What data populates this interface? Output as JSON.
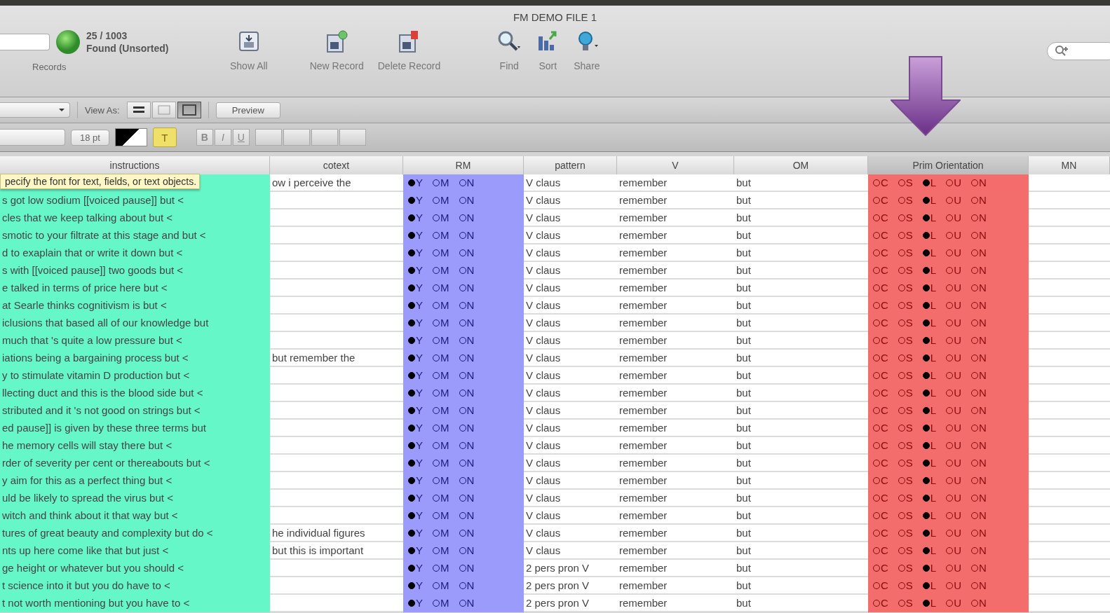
{
  "window": {
    "title": "FM DEMO FILE 1"
  },
  "toolbar": {
    "record_count": "25 / 1003",
    "found_status": "Found (Unsorted)",
    "records_label": "Records",
    "buttons": [
      {
        "label": "Show All",
        "kind": "show-all"
      },
      {
        "label": "New Record",
        "kind": "new"
      },
      {
        "label": "Delete Record",
        "kind": "delete"
      },
      {
        "label": "Find",
        "kind": "find"
      },
      {
        "label": "Sort",
        "kind": "sort"
      },
      {
        "label": "Share",
        "kind": "share"
      }
    ]
  },
  "layout_bar": {
    "view_as_label": "View As:",
    "views": [
      {
        "kind": "form",
        "selected": false
      },
      {
        "kind": "list",
        "selected": false
      },
      {
        "kind": "table",
        "selected": true
      }
    ],
    "preview_button": "Preview"
  },
  "format_bar": {
    "font_size": "18 pt",
    "text_button": {
      "label": "T",
      "selected": true
    },
    "styles": [
      "B",
      "I",
      "U"
    ]
  },
  "tooltip": "pecify the font for text, fields, or text objects.",
  "table": {
    "columns": [
      {
        "label": "instructions",
        "color": "#66f7c9",
        "selected": false
      },
      {
        "label": "cotext",
        "selected": false
      },
      {
        "label": "RM",
        "color": "#9b9bfb",
        "selected": false
      },
      {
        "label": "pattern",
        "selected": false
      },
      {
        "label": "V",
        "selected": false
      },
      {
        "label": "OM",
        "selected": false
      },
      {
        "label": "Prim Orientation",
        "color": "#f26d6b",
        "selected": true
      },
      {
        "label": "MN",
        "selected": false
      }
    ],
    "rows": [
      {
        "context": "ow i perceive the",
        "rm": [
          {
            "label": "Y",
            "selected": true
          },
          {
            "label": "M",
            "selected": false
          },
          {
            "label": "N",
            "selected": false
          }
        ],
        "pattern": "V claus",
        "v": "remember",
        "om": "but",
        "prim_orientation": [
          {
            "label": "C",
            "selected": false
          },
          {
            "label": "S",
            "selected": false
          },
          {
            "label": "L",
            "selected": true
          },
          {
            "label": "U",
            "selected": false
          },
          {
            "label": "N",
            "selected": false
          }
        ]
      },
      {
        "instructions": "s got low sodium [[voiced pause]] but <",
        "rm": [
          {
            "label": "Y",
            "selected": true
          },
          {
            "label": "M",
            "selected": false
          },
          {
            "label": "N",
            "selected": false
          }
        ],
        "pattern": "V claus",
        "v": "remember",
        "om": "but",
        "prim_orientation": [
          {
            "label": "C",
            "selected": false
          },
          {
            "label": "S",
            "selected": false
          },
          {
            "label": "L",
            "selected": true
          },
          {
            "label": "U",
            "selected": false
          },
          {
            "label": "N",
            "selected": false
          }
        ]
      },
      {
        "instructions": "cles that we keep talking about but <",
        "rm": [
          {
            "label": "Y",
            "selected": true
          },
          {
            "label": "M",
            "selected": false
          },
          {
            "label": "N",
            "selected": false
          }
        ],
        "pattern": "V claus",
        "v": "remember",
        "om": "but",
        "prim_orientation": [
          {
            "label": "C",
            "selected": false
          },
          {
            "label": "S",
            "selected": false
          },
          {
            "label": "L",
            "selected": true
          },
          {
            "label": "U",
            "selected": false
          },
          {
            "label": "N",
            "selected": false
          }
        ]
      },
      {
        "instructions": "smotic to your filtrate at this stage and but <",
        "rm": [
          {
            "label": "Y",
            "selected": true
          },
          {
            "label": "M",
            "selected": false
          },
          {
            "label": "N",
            "selected": false
          }
        ],
        "pattern": "V claus",
        "v": "remember",
        "om": "but",
        "prim_orientation": [
          {
            "label": "C",
            "selected": false
          },
          {
            "label": "S",
            "selected": false
          },
          {
            "label": "L",
            "selected": true
          },
          {
            "label": "U",
            "selected": false
          },
          {
            "label": "N",
            "selected": false
          }
        ]
      },
      {
        "instructions": "d to exaplain that or write it down but <",
        "rm": [
          {
            "label": "Y",
            "selected": true
          },
          {
            "label": "M",
            "selected": false
          },
          {
            "label": "N",
            "selected": false
          }
        ],
        "pattern": "V claus",
        "v": "remember",
        "om": "but",
        "prim_orientation": [
          {
            "label": "C",
            "selected": false
          },
          {
            "label": "S",
            "selected": false
          },
          {
            "label": "L",
            "selected": true
          },
          {
            "label": "U",
            "selected": false
          },
          {
            "label": "N",
            "selected": false
          }
        ]
      },
      {
        "instructions": "s with [[voiced pause]] two goods but <",
        "rm": [
          {
            "label": "Y",
            "selected": true
          },
          {
            "label": "M",
            "selected": false
          },
          {
            "label": "N",
            "selected": false
          }
        ],
        "pattern": "V claus",
        "v": "remember",
        "om": "but",
        "prim_orientation": [
          {
            "label": "C",
            "selected": false
          },
          {
            "label": "S",
            "selected": false
          },
          {
            "label": "L",
            "selected": true
          },
          {
            "label": "U",
            "selected": false
          },
          {
            "label": "N",
            "selected": false
          }
        ]
      },
      {
        "instructions": "e talked in terms of price here but <",
        "rm": [
          {
            "label": "Y",
            "selected": true
          },
          {
            "label": "M",
            "selected": false
          },
          {
            "label": "N",
            "selected": false
          }
        ],
        "pattern": "V claus",
        "v": "remember",
        "om": "but",
        "prim_orientation": [
          {
            "label": "C",
            "selected": false
          },
          {
            "label": "S",
            "selected": false
          },
          {
            "label": "L",
            "selected": true
          },
          {
            "label": "U",
            "selected": false
          },
          {
            "label": "N",
            "selected": false
          }
        ]
      },
      {
        "instructions": "at Searle thinks cognitivism is but <",
        "rm": [
          {
            "label": "Y",
            "selected": true
          },
          {
            "label": "M",
            "selected": false
          },
          {
            "label": "N",
            "selected": false
          }
        ],
        "pattern": "V claus",
        "v": "remember",
        "om": "but",
        "prim_orientation": [
          {
            "label": "C",
            "selected": false
          },
          {
            "label": "S",
            "selected": false
          },
          {
            "label": "L",
            "selected": true
          },
          {
            "label": "U",
            "selected": false
          },
          {
            "label": "N",
            "selected": false
          }
        ]
      },
      {
        "instructions": "iclusions that based all of our knowledge but",
        "rm": [
          {
            "label": "Y",
            "selected": true
          },
          {
            "label": "M",
            "selected": false
          },
          {
            "label": "N",
            "selected": false
          }
        ],
        "pattern": "V claus",
        "v": "remember",
        "om": "but",
        "prim_orientation": [
          {
            "label": "C",
            "selected": false
          },
          {
            "label": "S",
            "selected": false
          },
          {
            "label": "L",
            "selected": true
          },
          {
            "label": "U",
            "selected": false
          },
          {
            "label": "N",
            "selected": false
          }
        ]
      },
      {
        "instructions": "much that 's quite a low pressure but <",
        "rm": [
          {
            "label": "Y",
            "selected": true
          },
          {
            "label": "M",
            "selected": false
          },
          {
            "label": "N",
            "selected": false
          }
        ],
        "pattern": "V claus",
        "v": "remember",
        "om": "but",
        "prim_orientation": [
          {
            "label": "C",
            "selected": false
          },
          {
            "label": "S",
            "selected": false
          },
          {
            "label": "L",
            "selected": true
          },
          {
            "label": "U",
            "selected": false
          },
          {
            "label": "N",
            "selected": false
          }
        ]
      },
      {
        "instructions": "iations being a bargaining process but <",
        "context": "but remember the",
        "rm": [
          {
            "label": "Y",
            "selected": true
          },
          {
            "label": "M",
            "selected": false
          },
          {
            "label": "N",
            "selected": false
          }
        ],
        "pattern": "V claus",
        "v": "remember",
        "om": "but",
        "prim_orientation": [
          {
            "label": "C",
            "selected": false
          },
          {
            "label": "S",
            "selected": false
          },
          {
            "label": "L",
            "selected": true
          },
          {
            "label": "U",
            "selected": false
          },
          {
            "label": "N",
            "selected": false
          }
        ]
      },
      {
        "instructions": "y to stimulate vitamin D production but <",
        "rm": [
          {
            "label": "Y",
            "selected": true
          },
          {
            "label": "M",
            "selected": false
          },
          {
            "label": "N",
            "selected": false
          }
        ],
        "pattern": "V claus",
        "v": "remember",
        "om": "but",
        "prim_orientation": [
          {
            "label": "C",
            "selected": false
          },
          {
            "label": "S",
            "selected": false
          },
          {
            "label": "L",
            "selected": true
          },
          {
            "label": "U",
            "selected": false
          },
          {
            "label": "N",
            "selected": false
          }
        ]
      },
      {
        "instructions": "llecting duct and this is the blood side but <",
        "rm": [
          {
            "label": "Y",
            "selected": true
          },
          {
            "label": "M",
            "selected": false
          },
          {
            "label": "N",
            "selected": false
          }
        ],
        "pattern": "V claus",
        "v": "remember",
        "om": "but",
        "prim_orientation": [
          {
            "label": "C",
            "selected": false
          },
          {
            "label": "S",
            "selected": false
          },
          {
            "label": "L",
            "selected": true
          },
          {
            "label": "U",
            "selected": false
          },
          {
            "label": "N",
            "selected": false
          }
        ]
      },
      {
        "instructions": "stributed and it 's not good on strings but <",
        "rm": [
          {
            "label": "Y",
            "selected": true
          },
          {
            "label": "M",
            "selected": false
          },
          {
            "label": "N",
            "selected": false
          }
        ],
        "pattern": "V claus",
        "v": "remember",
        "om": "but",
        "prim_orientation": [
          {
            "label": "C",
            "selected": false
          },
          {
            "label": "S",
            "selected": false
          },
          {
            "label": "L",
            "selected": true
          },
          {
            "label": "U",
            "selected": false
          },
          {
            "label": "N",
            "selected": false
          }
        ]
      },
      {
        "instructions": "ed pause]] is given by these three terms but",
        "rm": [
          {
            "label": "Y",
            "selected": true
          },
          {
            "label": "M",
            "selected": false
          },
          {
            "label": "N",
            "selected": false
          }
        ],
        "pattern": "V claus",
        "v": "remember",
        "om": "but",
        "prim_orientation": [
          {
            "label": "C",
            "selected": false
          },
          {
            "label": "S",
            "selected": false
          },
          {
            "label": "L",
            "selected": true
          },
          {
            "label": "U",
            "selected": false
          },
          {
            "label": "N",
            "selected": false
          }
        ]
      },
      {
        "instructions": "he memory cells will stay there but <",
        "rm": [
          {
            "label": "Y",
            "selected": true
          },
          {
            "label": "M",
            "selected": false
          },
          {
            "label": "N",
            "selected": false
          }
        ],
        "pattern": "V claus",
        "v": "remember",
        "om": "but",
        "prim_orientation": [
          {
            "label": "C",
            "selected": false
          },
          {
            "label": "S",
            "selected": false
          },
          {
            "label": "L",
            "selected": true
          },
          {
            "label": "U",
            "selected": false
          },
          {
            "label": "N",
            "selected": false
          }
        ]
      },
      {
        "instructions": "rder of severity per cent or thereabouts but <",
        "rm": [
          {
            "label": "Y",
            "selected": true
          },
          {
            "label": "M",
            "selected": false
          },
          {
            "label": "N",
            "selected": false
          }
        ],
        "pattern": "V claus",
        "v": "remember",
        "om": "but",
        "prim_orientation": [
          {
            "label": "C",
            "selected": false
          },
          {
            "label": "S",
            "selected": false
          },
          {
            "label": "L",
            "selected": true
          },
          {
            "label": "U",
            "selected": false
          },
          {
            "label": "N",
            "selected": false
          }
        ]
      },
      {
        "instructions": "y aim for this as a perfect thing but <",
        "rm": [
          {
            "label": "Y",
            "selected": true
          },
          {
            "label": "M",
            "selected": false
          },
          {
            "label": "N",
            "selected": false
          }
        ],
        "pattern": "V claus",
        "v": "remember",
        "om": "but",
        "prim_orientation": [
          {
            "label": "C",
            "selected": false
          },
          {
            "label": "S",
            "selected": false
          },
          {
            "label": "L",
            "selected": true
          },
          {
            "label": "U",
            "selected": false
          },
          {
            "label": "N",
            "selected": false
          }
        ]
      },
      {
        "instructions": "uld be likely to spread the virus but <",
        "rm": [
          {
            "label": "Y",
            "selected": true
          },
          {
            "label": "M",
            "selected": false
          },
          {
            "label": "N",
            "selected": false
          }
        ],
        "pattern": "V claus",
        "v": "remember",
        "om": "but",
        "prim_orientation": [
          {
            "label": "C",
            "selected": false
          },
          {
            "label": "S",
            "selected": false
          },
          {
            "label": "L",
            "selected": true
          },
          {
            "label": "U",
            "selected": false
          },
          {
            "label": "N",
            "selected": false
          }
        ]
      },
      {
        "instructions": "witch and think about it that way but <",
        "rm": [
          {
            "label": "Y",
            "selected": true
          },
          {
            "label": "M",
            "selected": false
          },
          {
            "label": "N",
            "selected": false
          }
        ],
        "pattern": "V claus",
        "v": "remember",
        "om": "but",
        "prim_orientation": [
          {
            "label": "C",
            "selected": false
          },
          {
            "label": "S",
            "selected": false
          },
          {
            "label": "L",
            "selected": true
          },
          {
            "label": "U",
            "selected": false
          },
          {
            "label": "N",
            "selected": false
          }
        ]
      },
      {
        "instructions": "tures of great beauty and complexity but do <",
        "context": "he individual figures",
        "rm": [
          {
            "label": "Y",
            "selected": true
          },
          {
            "label": "M",
            "selected": false
          },
          {
            "label": "N",
            "selected": false
          }
        ],
        "pattern": "V claus",
        "v": "remember",
        "om": "but",
        "prim_orientation": [
          {
            "label": "C",
            "selected": false
          },
          {
            "label": "S",
            "selected": false
          },
          {
            "label": "L",
            "selected": true
          },
          {
            "label": "U",
            "selected": false
          },
          {
            "label": "N",
            "selected": false
          }
        ]
      },
      {
        "instructions": "nts up here come like that but just <",
        "context": "but this is important",
        "rm": [
          {
            "label": "Y",
            "selected": true
          },
          {
            "label": "M",
            "selected": false
          },
          {
            "label": "N",
            "selected": false
          }
        ],
        "pattern": "V claus",
        "v": "remember",
        "om": "but",
        "prim_orientation": [
          {
            "label": "C",
            "selected": false
          },
          {
            "label": "S",
            "selected": false
          },
          {
            "label": "L",
            "selected": true
          },
          {
            "label": "U",
            "selected": false
          },
          {
            "label": "N",
            "selected": false
          }
        ]
      },
      {
        "instructions": "ge height or whatever but you should <",
        "rm": [
          {
            "label": "Y",
            "selected": true
          },
          {
            "label": "M",
            "selected": false
          },
          {
            "label": "N",
            "selected": false
          }
        ],
        "pattern": "2 pers pron V",
        "v": "remember",
        "om": "but",
        "prim_orientation": [
          {
            "label": "C",
            "selected": false
          },
          {
            "label": "S",
            "selected": false
          },
          {
            "label": "L",
            "selected": true
          },
          {
            "label": "U",
            "selected": false
          },
          {
            "label": "N",
            "selected": false
          }
        ]
      },
      {
        "instructions": "t science into it but you do have to <",
        "rm": [
          {
            "label": "Y",
            "selected": true
          },
          {
            "label": "M",
            "selected": false
          },
          {
            "label": "N",
            "selected": false
          }
        ],
        "pattern": "2 pers pron V",
        "v": "remember",
        "om": "but",
        "prim_orientation": [
          {
            "label": "C",
            "selected": false
          },
          {
            "label": "S",
            "selected": false
          },
          {
            "label": "L",
            "selected": true
          },
          {
            "label": "U",
            "selected": false
          },
          {
            "label": "N",
            "selected": false
          }
        ]
      },
      {
        "instructions": "t not worth mentioning but you have to <",
        "rm": [
          {
            "label": "Y",
            "selected": true
          },
          {
            "label": "M",
            "selected": false
          },
          {
            "label": "N",
            "selected": false
          }
        ],
        "pattern": "2 pers pron V",
        "v": "remember",
        "om": "but",
        "prim_orientation": [
          {
            "label": "C",
            "selected": false
          },
          {
            "label": "S",
            "selected": false
          },
          {
            "label": "L",
            "selected": true
          },
          {
            "label": "U",
            "selected": false
          },
          {
            "label": "N",
            "selected": false
          }
        ]
      }
    ]
  }
}
